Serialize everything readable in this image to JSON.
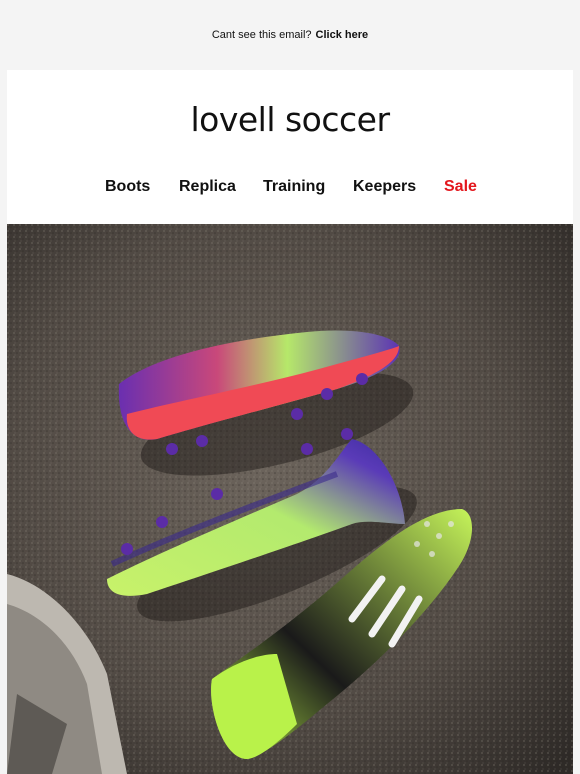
{
  "preheader": {
    "text": "Cant see this email?",
    "link": "Click here"
  },
  "brand": {
    "logo_text": "lovell soccer"
  },
  "nav": {
    "items": [
      "Boots",
      "Replica",
      "Training",
      "Keepers",
      "Sale"
    ]
  },
  "colors": {
    "sale": "#e3171d",
    "text": "#111111",
    "background": "#f4f4f4"
  },
  "hero": {
    "image": "football-boots-photo"
  }
}
